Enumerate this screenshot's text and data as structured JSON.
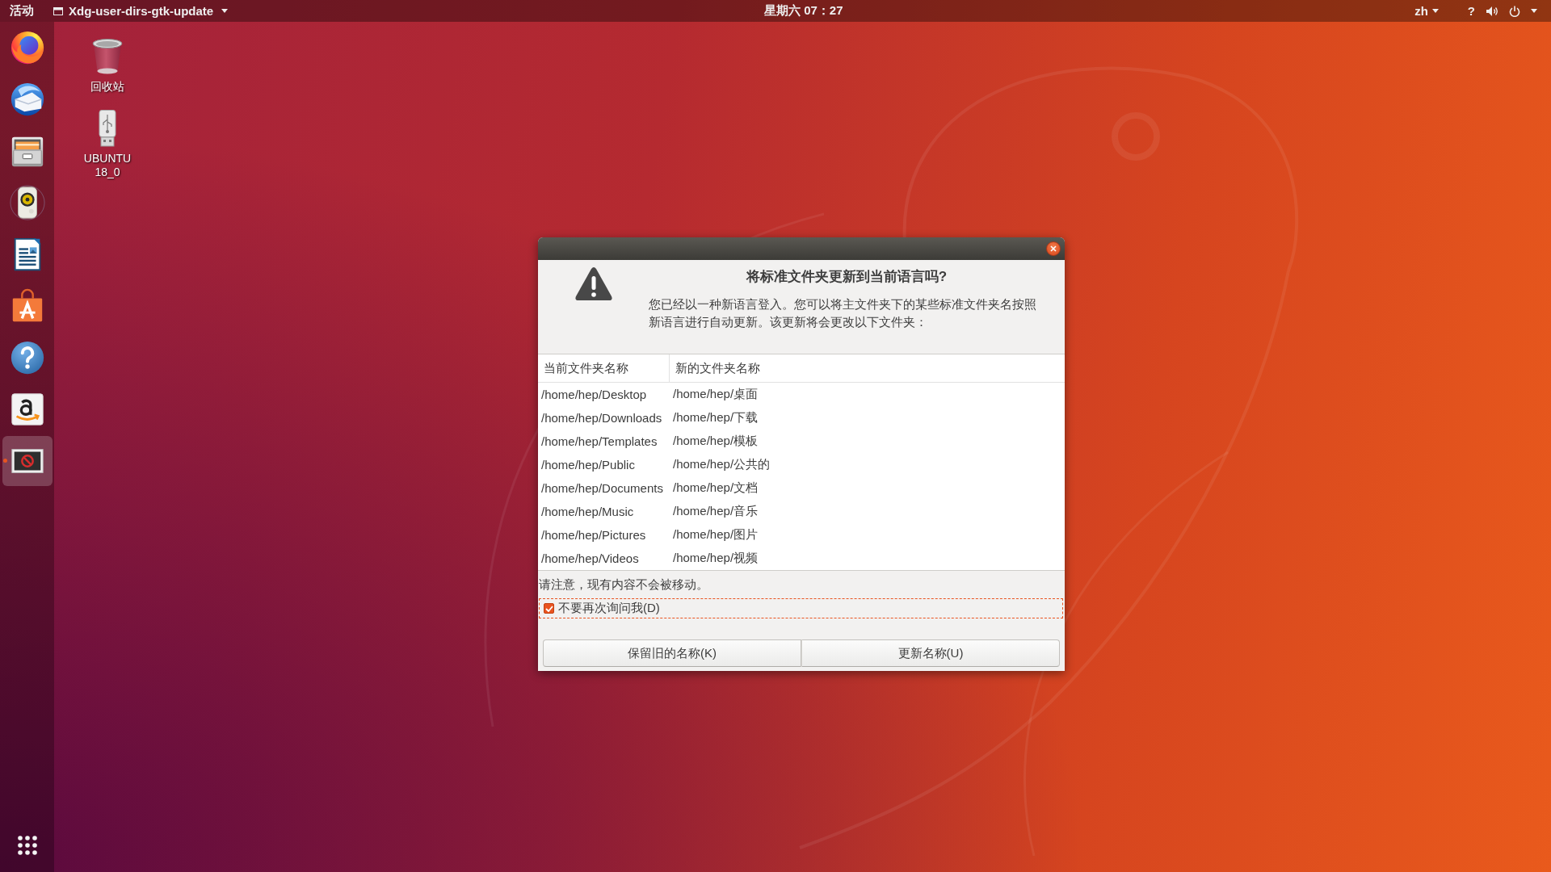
{
  "top_bar": {
    "activities": "活动",
    "app_menu": {
      "title": "Xdg-user-dirs-gtk-update"
    },
    "clock": "星期六 07：27",
    "input_method": "zh",
    "status_text": "?"
  },
  "dock": {
    "items": [
      {
        "running": false,
        "focused": false
      },
      {
        "running": false,
        "focused": false
      },
      {
        "running": false,
        "focused": false
      },
      {
        "running": false,
        "focused": false
      },
      {
        "running": false,
        "focused": false
      },
      {
        "running": false,
        "focused": false
      },
      {
        "running": false,
        "focused": false
      },
      {
        "running": false,
        "focused": false
      },
      {
        "running": true,
        "focused": true
      }
    ]
  },
  "desktop": {
    "icons": [
      {
        "label": "回收站"
      },
      {
        "label": "UBUNTU 18_0"
      }
    ]
  },
  "dialog": {
    "heading": "将标准文件夹更新到当前语言吗?",
    "message": "您已经以一种新语言登入。您可以将主文件夹下的某些标准文件夹名按照新语言进行自动更新。该更新将会更改以下文件夹：",
    "table": {
      "columns": [
        "当前文件夹名称",
        "新的文件夹名称"
      ],
      "rows": [
        [
          "/home/hep/Desktop",
          "/home/hep/桌面"
        ],
        [
          "/home/hep/Downloads",
          "/home/hep/下载"
        ],
        [
          "/home/hep/Templates",
          "/home/hep/模板"
        ],
        [
          "/home/hep/Public",
          "/home/hep/公共的"
        ],
        [
          "/home/hep/Documents",
          "/home/hep/文档"
        ],
        [
          "/home/hep/Music",
          "/home/hep/音乐"
        ],
        [
          "/home/hep/Pictures",
          "/home/hep/图片"
        ],
        [
          "/home/hep/Videos",
          "/home/hep/视频"
        ]
      ]
    },
    "note": "请注意，现有内容不会被移动。",
    "checkbox": {
      "label": "不要再次询问我(D)",
      "checked": true,
      "focused": true
    },
    "buttons": [
      "保留旧的名称(K)",
      "更新名称(U)"
    ]
  }
}
